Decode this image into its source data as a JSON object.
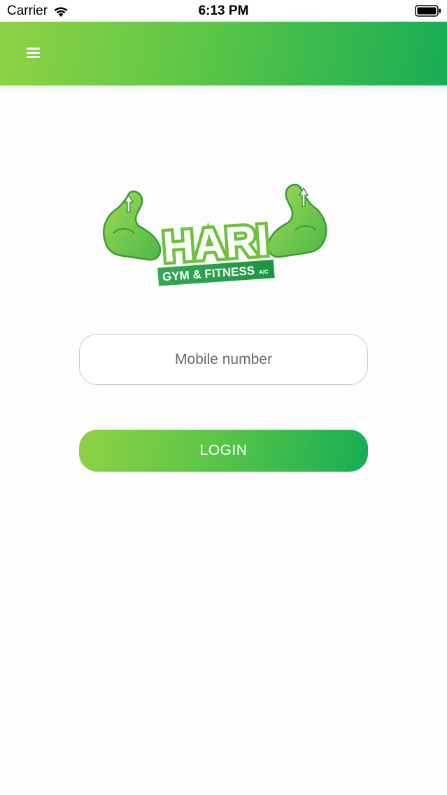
{
  "status_bar": {
    "carrier": "Carrier",
    "time": "6:13 PM",
    "wifi_icon": "wifi-icon",
    "battery_icon": "battery-full-icon"
  },
  "header": {
    "menu_icon": "hamburger-menu-icon",
    "gradient_start": "#8fd245",
    "gradient_end": "#17ad55"
  },
  "logo": {
    "title": "HARI",
    "subtitle": "GYM & FITNESS",
    "suffix": "A/C",
    "primary_color": "#67c23a",
    "accent_color": "#1f9e4a"
  },
  "login_form": {
    "mobile_placeholder": "Mobile number",
    "mobile_value": "",
    "login_label": "LOGIN"
  }
}
